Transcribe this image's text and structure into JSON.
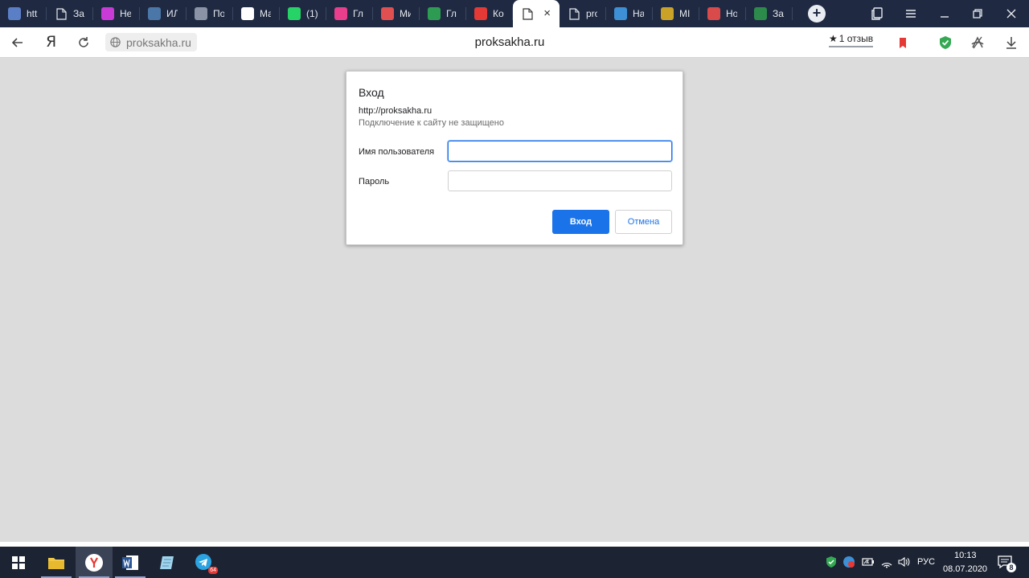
{
  "tabs": [
    {
      "title": "htt",
      "icon": "blue-grid-icon",
      "color": "#5b7fc7"
    },
    {
      "title": "За",
      "icon": "document-icon",
      "color": ""
    },
    {
      "title": "Не",
      "icon": "colorful-flower-icon",
      "color": "#c93bd6"
    },
    {
      "title": "ИЛ",
      "icon": "vk-icon",
      "color": "#4a76a8"
    },
    {
      "title": "По",
      "icon": "bank-icon",
      "color": "#8a94a6"
    },
    {
      "title": "Ма",
      "icon": "mk-icon",
      "color": "#ffffff"
    },
    {
      "title": "(1)",
      "icon": "whatsapp-icon",
      "color": "#25d366"
    },
    {
      "title": "Гл",
      "icon": "pink-sun-icon",
      "color": "#e83e8c"
    },
    {
      "title": "Ми",
      "icon": "red-circle-icon",
      "color": "#e05050"
    },
    {
      "title": "Гл",
      "icon": "green-stripes-icon",
      "color": "#2e9b52"
    },
    {
      "title": "Ко",
      "icon": "red-shield-icon",
      "color": "#e53935"
    },
    {
      "title": "",
      "icon": "document-icon",
      "color": "",
      "active": true
    },
    {
      "title": "pro",
      "icon": "document-icon",
      "color": ""
    },
    {
      "title": "На",
      "icon": "snowflake-icon",
      "color": "#3d8fd6"
    },
    {
      "title": "МІ",
      "icon": "gold-emblem-icon",
      "color": "#c9a227"
    },
    {
      "title": "Но",
      "icon": "news-icon",
      "color": "#d94a4a"
    },
    {
      "title": "За",
      "icon": "green-logo-icon",
      "color": "#2c8a4b"
    }
  ],
  "newtab_label": "+",
  "tab_close_label": "×",
  "toolbar": {
    "ya_label": "Я",
    "url_chip": "proksakha.ru",
    "host": "proksakha.ru",
    "review_star": "★",
    "review_text": "1 отзыв"
  },
  "dialog": {
    "title": "Вход",
    "url": "http://proksakha.ru",
    "warning": "Подключение к сайту не защищено",
    "username_label": "Имя пользователя",
    "username_value": "",
    "password_label": "Пароль",
    "password_value": "",
    "login_button": "Вход",
    "cancel_button": "Отмена"
  },
  "taskbar": {
    "language": "РУС",
    "time": "10:13",
    "date": "08.07.2020",
    "notification_count": "8",
    "telegram_badge": "64"
  },
  "colors": {
    "accent": "#1a73e8",
    "tabstrip": "#1f2a42",
    "taskbar": "#1c2333",
    "page_bg": "#dcdcdc"
  }
}
